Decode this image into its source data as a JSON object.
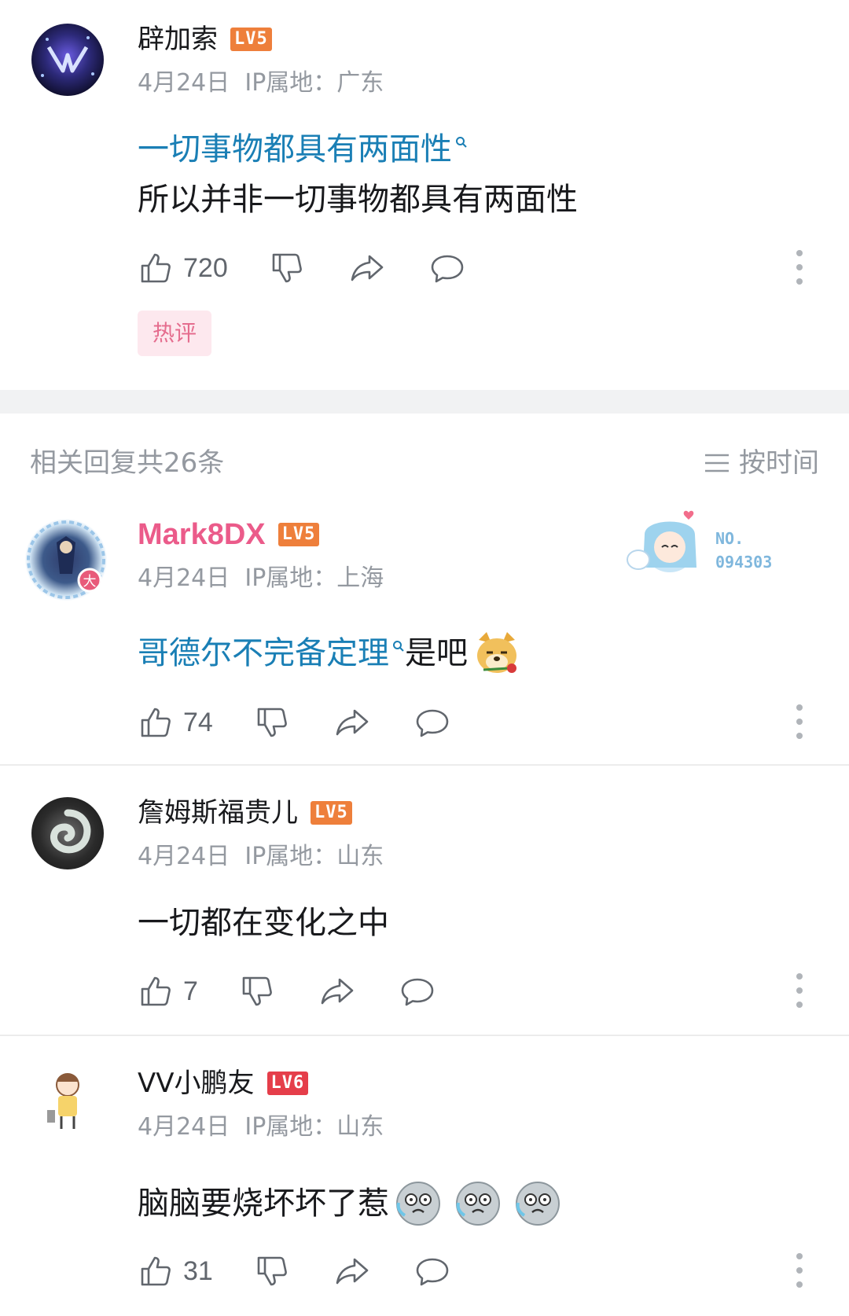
{
  "top_comment": {
    "username": "辟加索",
    "level": "LV5",
    "date": "4月24日",
    "ip": "IP属地：广东",
    "content_link": "一切事物都具有两面性",
    "content_text": "所以并非一切事物都具有两面性",
    "likes": "720",
    "hot_tag": "热评"
  },
  "replies_header": {
    "count_label": "相关回复共26条",
    "sort_label": "按时间"
  },
  "replies": [
    {
      "username": "Mark8DX",
      "level": "LV5",
      "date": "4月24日",
      "ip": "IP属地：上海",
      "content_link": "哥德尔不完备定理",
      "content_text": "是吧",
      "likes": "74",
      "avatar_badge": "大",
      "card_no": "NO.",
      "card_num": "094303"
    },
    {
      "username": "詹姆斯福贵儿",
      "level": "LV5",
      "date": "4月24日",
      "ip": "IP属地：山东",
      "content_text": "一切都在变化之中",
      "likes": "7"
    },
    {
      "username": "VV小鹏友",
      "level": "LV6",
      "date": "4月24日",
      "ip": "IP属地：山东",
      "content_text": "脑脑要烧坏坏了惹",
      "likes": "31"
    }
  ],
  "colors": {
    "link": "#1a7fb5",
    "vip_name": "#eb5b8a",
    "lv5": "#ee7f3b",
    "lv6": "#e53e4a",
    "meta": "#9499a0"
  },
  "icons": [
    "like-icon",
    "dislike-icon",
    "share-icon",
    "reply-icon",
    "more-icon",
    "search-icon",
    "sort-icon"
  ]
}
